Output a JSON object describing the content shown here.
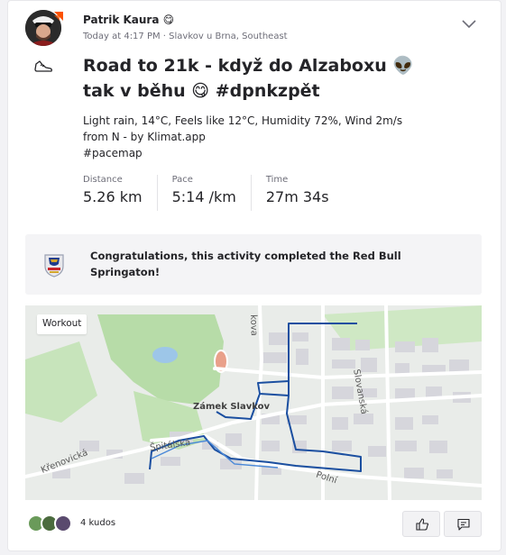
{
  "athlete": {
    "name": "Patrik Kaura 😋",
    "meta": "Today at 4:17 PM · Slavkov u Brna, Southeast"
  },
  "activity": {
    "title_line1": "Road to 21k - když do Alzaboxu 👽",
    "title_line2": "tak v běhu 😋 #dpnkzpět",
    "description": [
      "Light rain, 14°C, Feels like 12°C, Humidity 72%, Wind 2m/s",
      "from N - by Klimat.app",
      "#pacemap"
    ],
    "stats": [
      {
        "label": "Distance",
        "value": "5.26 km"
      },
      {
        "label": "Pace",
        "value": "5:14 /km"
      },
      {
        "label": "Time",
        "value": "27m 34s"
      }
    ]
  },
  "challenge": {
    "text": "Congratulations, this activity completed the Red Bull Springaton!"
  },
  "map": {
    "tag": "Workout",
    "labels": {
      "castle": "Zámek Slavkov",
      "slovanska": "Slovanská",
      "spitalska": "Špitálská",
      "krenovicka": "Křenovická",
      "polni": "Polní",
      "top_street": "kova"
    }
  },
  "footer": {
    "kudos": "4 kudos"
  },
  "colors": {
    "route": "#1b4fa0",
    "accent": "#fc5200",
    "park": "#a9d39a",
    "water": "#9dc6e8",
    "building": "#d9d9de"
  },
  "icons": {
    "options": "chevron-down-icon",
    "sport": "running-shoe-icon",
    "kudos": "thumbs-up-icon",
    "comment": "comment-icon",
    "challenge": "trophy-icon"
  }
}
